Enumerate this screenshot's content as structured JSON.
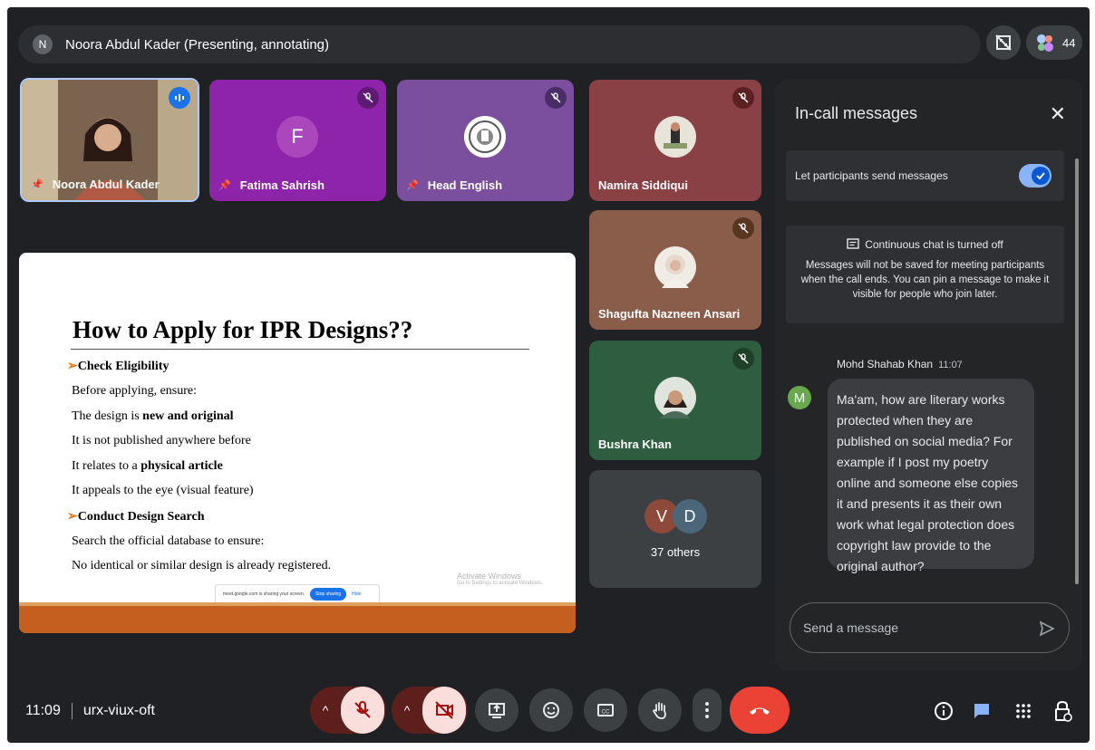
{
  "presenter_bar": {
    "avatar_letter": "N",
    "title": "Noora Abdul Kader (Presenting, annotating)"
  },
  "people_count": "44",
  "tiles": [
    {
      "name": "Noora Abdul Kader",
      "bg": "#5a4a3a"
    },
    {
      "name": "Fatima Sahrish",
      "letter": "F",
      "bg": "#8e24aa"
    },
    {
      "name": "Head English",
      "bg": "#7b4f9e"
    },
    {
      "name": "Namira Siddiqui",
      "bg": "#8a4146"
    },
    {
      "name": "Shagufta Nazneen Ansari",
      "bg": "#8a5c4a"
    },
    {
      "name": "Bushra Khan",
      "bg": "#2e5e3f"
    }
  ],
  "others": {
    "letters": [
      "V",
      "D"
    ],
    "label": "37 others"
  },
  "slide": {
    "title": "How to Apply for IPR Designs??",
    "lines": [
      {
        "arrow": "➢",
        "text": "Check Eligibility",
        "bold": true
      },
      {
        "text": "Before applying, ensure:"
      },
      {
        "pre": "The design is ",
        "boldpart": "new and original"
      },
      {
        "text": "It is not published anywhere before"
      },
      {
        "pre": "It relates to a ",
        "boldpart": "physical article"
      },
      {
        "text": "It appeals to the eye (visual feature)"
      },
      {
        "arrow": "➢",
        "text": "Conduct Design Search",
        "bold": true
      },
      {
        "text": "Search the official database to ensure:"
      },
      {
        "text": "No identical or similar design is already registered."
      }
    ],
    "share_text": "meet.google.com is sharing your screen.",
    "stop_sharing": "Stop sharing",
    "hide": "Hide",
    "watermark_title": "Activate Windows",
    "watermark_sub": "Go to Settings to activate Windows."
  },
  "chat": {
    "title": "In-call messages",
    "toggle_label": "Let participants send messages",
    "info_title": "Continuous chat is turned off",
    "info_text": "Messages will not be saved for meeting participants when the call ends. You can pin a message to make it visible for people who join later.",
    "sender": "Mohd Shahab Khan",
    "time": "11:07",
    "sender_letter": "M",
    "message": "Ma'am, how are literary works protected when they are published on social media? For example if I post my poetry online and someone else copies it and presents it as their own work what legal protection does copyright law provide to the original author?",
    "placeholder": "Send a message"
  },
  "footer": {
    "time": "11:09",
    "meeting_code": "urx-viux-oft"
  },
  "colors": {
    "accent": "#8ab4f8",
    "end_call": "#ea4335"
  }
}
